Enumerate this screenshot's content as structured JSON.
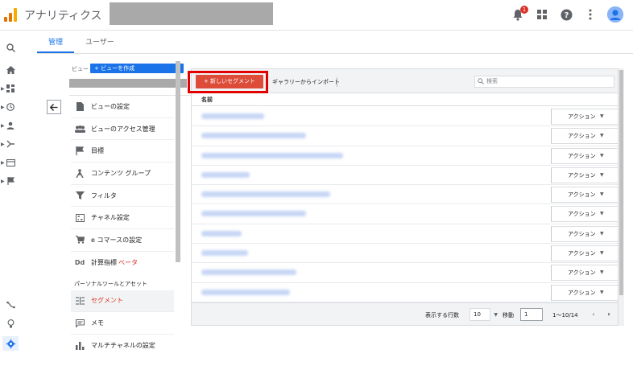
{
  "app": {
    "title": "アナリティクス",
    "notification_count": "1",
    "logo_colors": [
      "#f9ab00",
      "#e37400",
      "#e37400"
    ]
  },
  "tabs": [
    {
      "label": "管理",
      "active": true
    },
    {
      "label": "ユーザー",
      "active": false
    }
  ],
  "admin": {
    "view_label": "ビュー",
    "create_view_label": "+ ビューを作成",
    "items": [
      {
        "label": "ビューの設定",
        "icon": "document-icon"
      },
      {
        "label": "ビューのアクセス管理",
        "icon": "people-icon"
      },
      {
        "label": "目標",
        "icon": "flag-icon"
      },
      {
        "label": "コンテンツ グループ",
        "icon": "content-group-icon"
      },
      {
        "label": "フィルタ",
        "icon": "filter-icon"
      },
      {
        "label": "チャネル設定",
        "icon": "channel-icon"
      },
      {
        "label": "e コマースの設定",
        "icon": "cart-icon"
      },
      {
        "label": "計算指標",
        "icon": "dd-icon",
        "suffix": "ベータ"
      }
    ],
    "section_title": "パーソナルツールとアセット",
    "section_items": [
      {
        "label": "セグメント",
        "icon": "segment-icon",
        "selected": true
      },
      {
        "label": "メモ",
        "icon": "note-icon"
      },
      {
        "label": "マルチチャネルの設定",
        "icon": "bar-chart-icon"
      }
    ]
  },
  "segments": {
    "new_button_label": "+ 新しいセグメント",
    "import_label": "ギャラリーからインポート",
    "search_placeholder": "検索",
    "column_name": "名前",
    "action_label": "アクション",
    "row_count": 10
  },
  "footer": {
    "rows_label": "表示する行数",
    "rows_value": "10",
    "goto_label": "移動",
    "goto_value": "1",
    "range_label": "1〜10/14",
    "prev": "‹",
    "next": "›"
  },
  "colors": {
    "accent": "#1a73e8",
    "new_segment": "#dd4b39",
    "highlight_box": "#e30000"
  }
}
